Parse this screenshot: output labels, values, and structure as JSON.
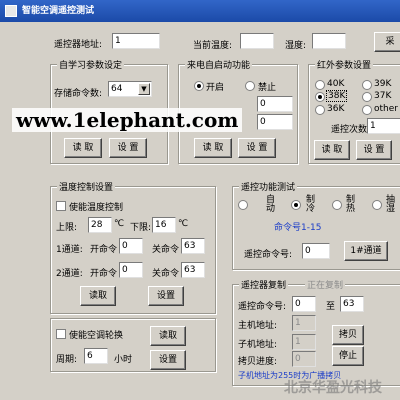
{
  "window": {
    "title": "智能空调遥控测试"
  },
  "top": {
    "remote_addr_label": "遥控器地址:",
    "remote_addr_value": "1",
    "temp_label": "当前温度:",
    "temp_value": "",
    "humidity_label": "湿度:",
    "humidity_value": "",
    "edge_button": "采"
  },
  "self_learn": {
    "legend": "自学习参数设定",
    "store_label": "存储命令数:",
    "store_value": "64",
    "read_btn": "读 取",
    "set_btn": "设 置"
  },
  "power_restore": {
    "legend": "来电自启动功能",
    "on_label": "开启",
    "off_label": "禁止",
    "field1": "0",
    "field2": "0",
    "read_btn": "读 取",
    "set_btn": "设 置"
  },
  "ir": {
    "legend": "红外参数设置",
    "opts": [
      "40K",
      "39K",
      "38K",
      "37K",
      "36K",
      "other"
    ],
    "count_label": "遥控次数:",
    "count_value": "1",
    "read_btn": "读 取",
    "set_btn": "设 置"
  },
  "temp_ctrl": {
    "legend": "温度控制设置",
    "enable_label": "使能温度控制",
    "upper_label": "上限:",
    "upper_value": "28",
    "upper_unit": "℃",
    "lower_label": "下限:",
    "lower_value": "16",
    "lower_unit": "℃",
    "ch1_label": "1通道:",
    "ch2_label": "2通道:",
    "on_cmd_label": "开命令",
    "off_cmd_label": "关命令",
    "ch1_on": "0",
    "ch1_off": "63",
    "ch2_on": "0",
    "ch2_off": "63",
    "read_btn": "读取",
    "set_btn": "设置"
  },
  "rotation": {
    "enable_label": "使能空调轮换",
    "period_label": "周期:",
    "period_value": "6",
    "unit": "小时",
    "read_btn": "读取",
    "set_btn": "设置"
  },
  "remote_test": {
    "legend": "遥控功能测试",
    "modes": [
      "自动",
      "制冷",
      "制热",
      "抽湿"
    ],
    "cmd_range": "命令号1-15",
    "cmd_label": "遥控命令号:",
    "cmd_value": "0",
    "ch_btn": "1#通道"
  },
  "copy": {
    "legend": "遥控器复制",
    "status": "正在复制",
    "cmd_label": "遥控命令号:",
    "cmd_from": "0",
    "to_label": "至",
    "cmd_to": "63",
    "host_label": "主机地址:",
    "host_value": "1",
    "slave_label": "子机地址:",
    "slave_value": "1",
    "progress_label": "拷贝进度:",
    "progress_value": "0",
    "copy_btn": "拷贝",
    "stop_btn": "停止",
    "hint": "子机地址为255时为广播拷贝"
  },
  "watermark": {
    "site": "www.1elephant.com",
    "company": "北京华盈光科技"
  }
}
